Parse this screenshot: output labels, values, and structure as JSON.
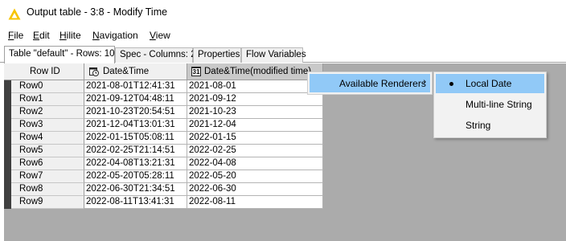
{
  "window": {
    "title": "Output table - 3:8 - Modify Time"
  },
  "menu": [
    {
      "mnemonic": "F",
      "rest": "ile"
    },
    {
      "mnemonic": "E",
      "rest": "dit"
    },
    {
      "mnemonic": "H",
      "rest": "ilite"
    },
    {
      "mnemonic": "N",
      "rest": "avigation"
    },
    {
      "mnemonic": "V",
      "rest": "iew"
    }
  ],
  "tabs": [
    {
      "label": "Table \"default\" - Rows: 10",
      "active": true
    },
    {
      "label": "Spec - Columns: 2",
      "active": false
    },
    {
      "label": "Properties",
      "active": false
    },
    {
      "label": "Flow Variables",
      "active": false
    }
  ],
  "table": {
    "headers": {
      "row_id": "Row ID",
      "col1": "Date&Time",
      "col2": "Date&Time(modified time)"
    },
    "col2_icon_text": "31",
    "rows": [
      {
        "id": "Row0",
        "datetime": "2021-08-01T12:41:31",
        "modified": "2021-08-01"
      },
      {
        "id": "Row1",
        "datetime": "2021-09-12T04:48:11",
        "modified": "2021-09-12"
      },
      {
        "id": "Row2",
        "datetime": "2021-10-23T20:54:51",
        "modified": "2021-10-23"
      },
      {
        "id": "Row3",
        "datetime": "2021-12-04T13:01:31",
        "modified": "2021-12-04"
      },
      {
        "id": "Row4",
        "datetime": "2022-01-15T05:08:11",
        "modified": "2022-01-15"
      },
      {
        "id": "Row5",
        "datetime": "2022-02-25T21:14:51",
        "modified": "2022-02-25"
      },
      {
        "id": "Row6",
        "datetime": "2022-04-08T13:21:31",
        "modified": "2022-04-08"
      },
      {
        "id": "Row7",
        "datetime": "2022-05-20T05:28:11",
        "modified": "2022-05-20"
      },
      {
        "id": "Row8",
        "datetime": "2022-06-30T21:34:51",
        "modified": "2022-06-30"
      },
      {
        "id": "Row9",
        "datetime": "2022-08-11T13:41:31",
        "modified": "2022-08-11"
      }
    ]
  },
  "context_menu": {
    "item": "Available Renderers",
    "submenu": [
      {
        "label": "Local Date",
        "selected": true
      },
      {
        "label": "Multi-line String",
        "selected": false
      },
      {
        "label": "String",
        "selected": false
      }
    ]
  },
  "colors": {
    "highlight": "#91c9f7",
    "header_bg": "#f0f0f0",
    "selected_header_bg": "#c9c9c9",
    "table_bg": "#ababab",
    "row_marker": "#404040"
  }
}
